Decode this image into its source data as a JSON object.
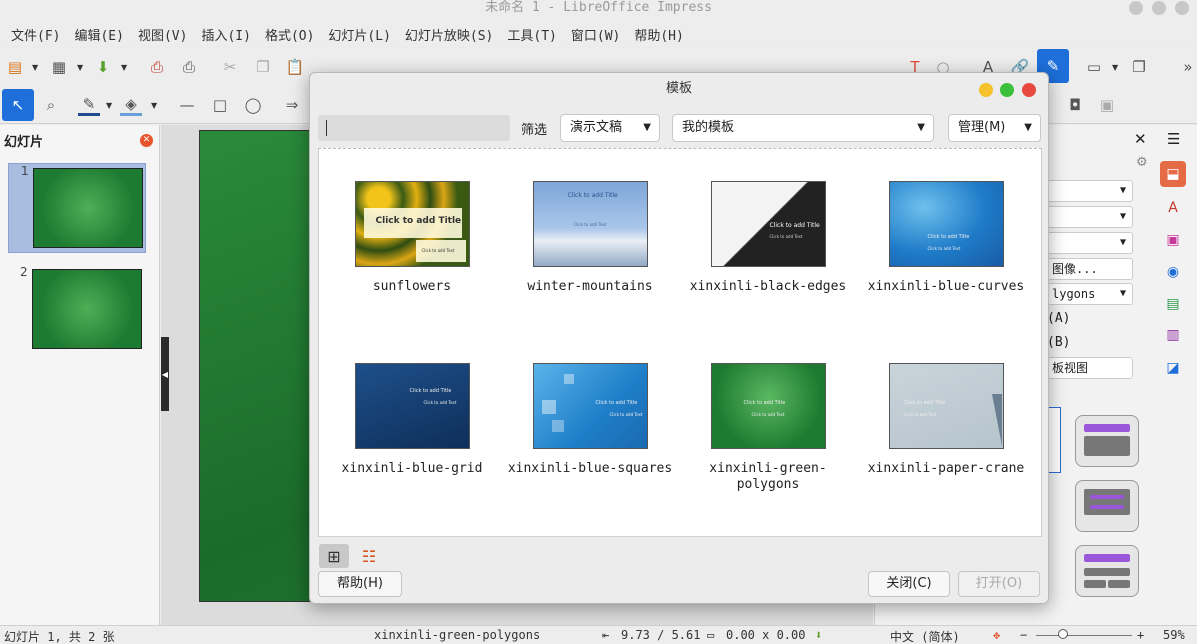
{
  "window": {
    "title": "未命名 1 - LibreOffice Impress"
  },
  "menubar": {
    "items": [
      "文件(F)",
      "编辑(E)",
      "视图(V)",
      "插入(I)",
      "格式(O)",
      "幻灯片(L)",
      "幻灯片放映(S)",
      "工具(T)",
      "窗口(W)",
      "帮助(H)"
    ]
  },
  "slide_pane": {
    "title": "幻灯片",
    "slides": [
      {
        "number": "1"
      },
      {
        "number": "2"
      }
    ]
  },
  "sidebar": {
    "partial_texts": [
      "图像...",
      "lygons",
      "(A)",
      "(B)",
      "板视图"
    ]
  },
  "dialog": {
    "title": "模板",
    "search_value": "",
    "filter_label": "筛选",
    "filter_value": "演示文稿",
    "category_value": "我的模板",
    "manage_label": "管理(M)",
    "help_label": "帮助(H)",
    "close_label": "关闭(C)",
    "open_label": "打开(O)",
    "templates": [
      {
        "name": "sunflowers",
        "thumb_title": "Click to add Title",
        "thumb_text": "Click to add Text"
      },
      {
        "name": "winter-mountains",
        "thumb_title": "Click to add Title",
        "thumb_text": "Click to add Text"
      },
      {
        "name": "xinxinli-black-edges",
        "thumb_title": "Click to add Title",
        "thumb_text": "Click to add Text"
      },
      {
        "name": "xinxinli-blue-curves",
        "thumb_title": "Click to add Title",
        "thumb_text": "Click to add Text"
      },
      {
        "name": "xinxinli-blue-grid",
        "thumb_title": "Click to add Title",
        "thumb_text": "Click to add Text"
      },
      {
        "name": "xinxinli-blue-squares",
        "thumb_title": "Click to add Title",
        "thumb_text": "Click to add Text"
      },
      {
        "name": "xinxinli-green-polygons",
        "thumb_title": "Click to add Title",
        "thumb_text": "Click to add Text"
      },
      {
        "name": "xinxinli-paper-crane",
        "thumb_title": "Click to add Title",
        "thumb_text": "Click to add Text"
      }
    ]
  },
  "statusbar": {
    "slide_info": "幻灯片 1, 共 2 张",
    "template_name": "xinxinli-green-polygons",
    "position": "9.73 / 5.61",
    "size": "0.00 x 0.00",
    "language": "中文 (简体)",
    "zoom": "59%"
  },
  "colors": {
    "accent_blue": "#1e6fd9",
    "traffic_yellow": "#f5c22b",
    "traffic_green": "#3cc03c",
    "traffic_red": "#e8493f"
  }
}
